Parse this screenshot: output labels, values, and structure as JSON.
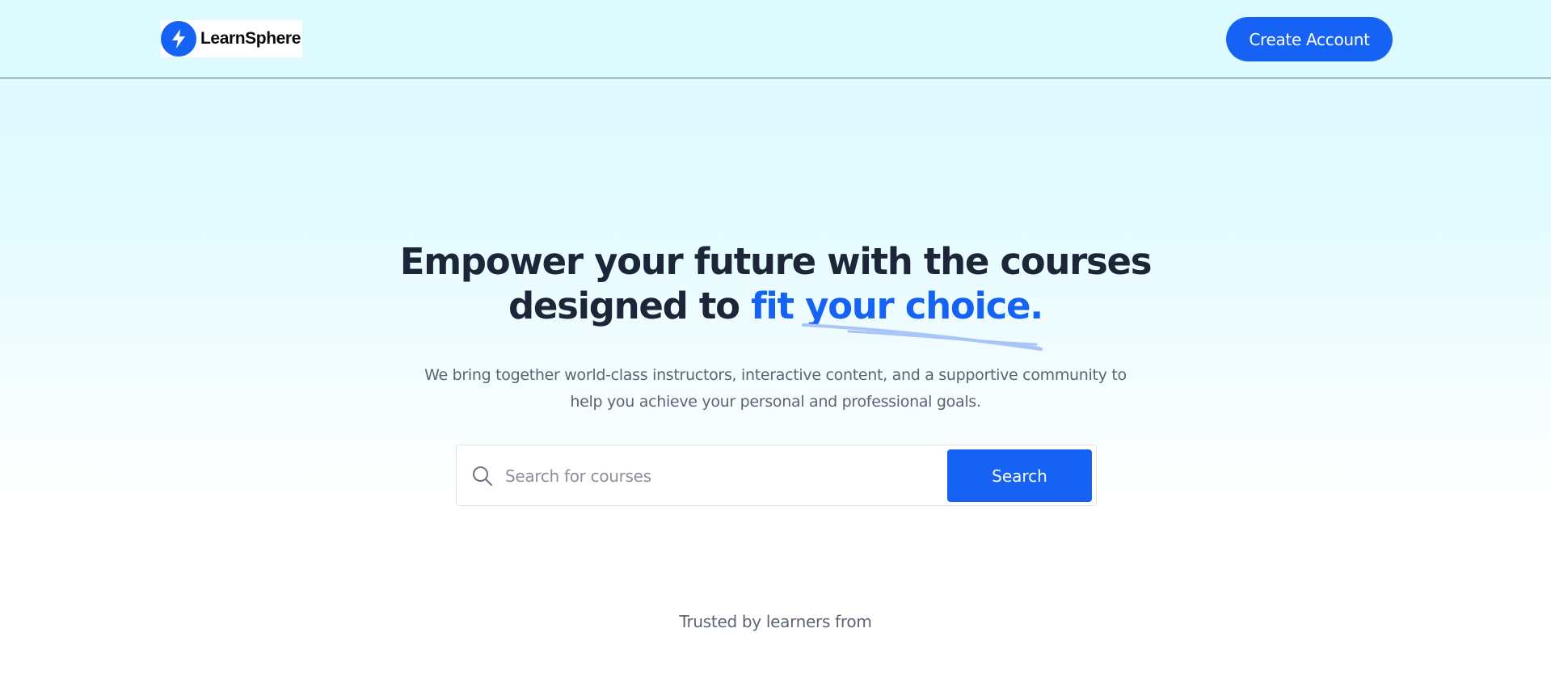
{
  "header": {
    "logo_text": "LearnSphere",
    "create_account_label": "Create Account"
  },
  "hero": {
    "title_line1": "Empower your future with the courses",
    "title_line2_prefix": "designed to ",
    "title_line2_highlight": "fit your choice.",
    "subtitle_line1": "We bring together world-class instructors, interactive content, and a supportive community to",
    "subtitle_line2": "help you achieve your personal and professional goals."
  },
  "search": {
    "placeholder": "Search for courses",
    "value": "",
    "button_label": "Search",
    "icon": "search-icon"
  },
  "trusted": {
    "label": "Trusted by learners from"
  },
  "colors": {
    "accent": "#1662f5",
    "heading": "#1c2638",
    "muted": "#5b6473",
    "scribble": "#a9c4f7"
  }
}
